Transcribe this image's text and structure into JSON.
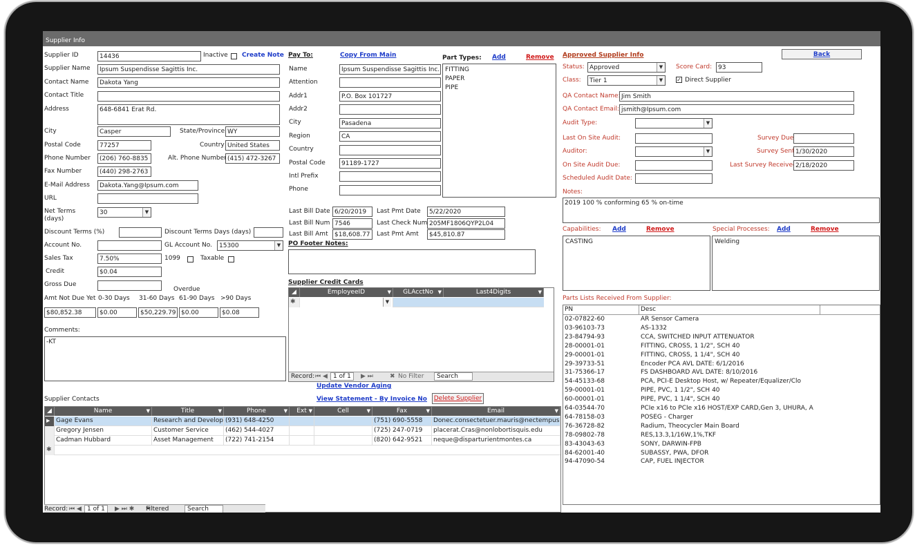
{
  "window_title": "Supplier Info",
  "supplier": {
    "labels": {
      "supplier_id": "Supplier ID",
      "inactive": "Inactive",
      "supplier_name": "Supplier Name",
      "contact_name": "Contact Name",
      "contact_title": "Contact Title",
      "address": "Address",
      "city": "City",
      "state": "State/Province",
      "postal": "Postal Code",
      "country": "Country",
      "phone": "Phone Number",
      "alt_phone": "Alt. Phone Number:",
      "fax": "Fax Number",
      "email": "E-Mail Address",
      "url": "URL",
      "net_terms": "Net Terms\n(days)",
      "discount_terms": "Discount Terms (%)",
      "discount_days": "Discount Terms Days (days)",
      "account_no": "Account No.",
      "gl_account": "GL Account No.",
      "sales_tax": "Sales Tax",
      "form_1099": "1099",
      "taxable": "Taxable",
      "credit": "Credit",
      "gross_due": "Gross Due",
      "overdue": "Overdue",
      "amt_not_due": "Amt Not Due Yet",
      "d0_30": "0-30 Days",
      "d31_60": "31-60 Days",
      "d61_90": "61-90 Days",
      "d90": ">90 Days",
      "comments": "Comments:"
    },
    "create_note": "Create Note",
    "values": {
      "supplier_id": "14436",
      "supplier_name": "Ipsum Suspendisse Sagittis Inc.",
      "contact_name": "Dakota Yang",
      "contact_title": "",
      "address": "648-6841 Erat Rd.",
      "city": "Casper",
      "state": "WY",
      "postal": "77257",
      "country": "United States",
      "phone": "(206) 760-8835",
      "alt_phone": "(415) 472-3267",
      "fax": "(440) 298-2763",
      "email": "Dakota.Yang@Ipsum.com",
      "url": "",
      "net_terms": "30",
      "discount_terms": "",
      "discount_days": "",
      "account_no": "",
      "gl_account": "15300",
      "sales_tax": "7.50%",
      "credit": "$0.04",
      "gross_due": "",
      "amt_not_due": "$80,852.38",
      "d0_30": "$0.00",
      "d31_60": "$50,229.79",
      "d61_90": "$0.00",
      "d90": "$0.08",
      "comments": "-KT"
    }
  },
  "pay_to": {
    "header": "Pay To:",
    "copy_from_main": "Copy From Main",
    "labels": {
      "name": "Name",
      "attention": "Attention",
      "addr1": "Addr1",
      "addr2": "Addr2",
      "city": "City",
      "region": "Region",
      "country": "Country",
      "postal": "Postal Code",
      "intl_prefix": "Intl Prefix",
      "phone": "Phone"
    },
    "values": {
      "name": "Ipsum Suspendisse Sagittis Inc.",
      "attention": "",
      "addr1": "P.O. Box 101727",
      "addr2": "",
      "city": "Pasadena",
      "region": "CA",
      "country": "",
      "postal": "91189-1727",
      "intl_prefix": "",
      "phone": ""
    }
  },
  "part_types": {
    "label": "Part Types:",
    "add": "Add",
    "remove": "Remove",
    "items": [
      "FITTING",
      "PAPER",
      "PIPE"
    ]
  },
  "billing": {
    "labels": {
      "last_bill_date": "Last Bill Date",
      "last_pmt_date": "Last Pmt Date",
      "last_bill_num": "Last Bill Num",
      "last_check_num": "Last Check Num",
      "last_bill_amt": "Last Bill Amt",
      "last_pmt_amt": "Last Pmt Amt"
    },
    "values": {
      "last_bill_date": "6/20/2019",
      "last_pmt_date": "5/22/2020",
      "last_bill_num": "7546",
      "last_check_num": "205MF1806QYP2L04",
      "last_bill_amt": "$18,608.77",
      "last_pmt_amt": "$45,810.87"
    }
  },
  "po_footer_label": "PO Footer Notes:",
  "credit_cards": {
    "label": "Supplier Credit Cards",
    "columns": [
      "EmployeeID",
      "GLAcctNo",
      "Last4Digits"
    ],
    "nav": {
      "record": "Record:",
      "pos": "1 of 1",
      "filter": "No Filter",
      "search": "Search"
    }
  },
  "links": {
    "update_vendor_aging": "Update Vendor Aging",
    "view_statement": "View Statement - By Invoice No",
    "delete_supplier": "Delete Supplier"
  },
  "contacts": {
    "label": "Supplier Contacts",
    "columns": [
      "Name",
      "Title",
      "Phone",
      "Ext",
      "Cell",
      "Fax",
      "Email"
    ],
    "rows": [
      [
        "Gage Evans",
        "Research and Developm",
        "(931) 648-4250",
        "",
        "",
        "(751) 690-5558",
        "Donec.consectetuer.mauris@nectempus"
      ],
      [
        "Gregory Jensen",
        "Customer Service",
        "(462) 544-4027",
        "",
        "",
        "(725) 247-0719",
        "placerat.Cras@nonlobortisquis.edu"
      ],
      [
        "Cadman Hubbard",
        "Asset Management",
        "(722) 741-2154",
        "",
        "",
        "(820) 642-9521",
        "neque@disparturientmontes.ca"
      ]
    ],
    "nav": {
      "record": "Record:",
      "pos": "1 of 1",
      "filtered": "Filtered",
      "search": "Search"
    }
  },
  "approved": {
    "header": "Approved Supplier Info",
    "back": "Back",
    "labels": {
      "status": "Status:",
      "score_card": "Score Card:",
      "class": "Class:",
      "direct": "Direct Supplier",
      "qa_contact_name": "QA Contact Name:",
      "qa_contact_email": "QA Contact Email:",
      "audit_type": "Audit Type:",
      "last_on_site": "Last On Site Audit:",
      "survey_due": "Survey Due:",
      "auditor": "Auditor:",
      "survey_sent": "Survey Sent:",
      "on_site_due": "On Site Audit Due:",
      "last_survey": "Last Survey Received:",
      "scheduled": "Scheduled Audit Date:",
      "notes": "Notes:"
    },
    "values": {
      "status": "Approved",
      "score_card": "93",
      "class": "Tier 1",
      "qa_contact_name": "Jim Smith",
      "qa_contact_email": "jsmith@Ipsum.com",
      "audit_type": "",
      "last_on_site": "",
      "survey_due": "",
      "auditor": "",
      "survey_sent": "1/30/2020",
      "on_site_due": "",
      "last_survey": "2/18/2020",
      "scheduled": "",
      "notes": "2019 100 % conforming 65 % on-time"
    }
  },
  "capabilities": {
    "label": "Capabilities:",
    "add": "Add",
    "remove": "Remove",
    "items": [
      "CASTING"
    ]
  },
  "special_processes": {
    "label": "Special Processes:",
    "add": "Add",
    "remove": "Remove",
    "items": [
      "Welding"
    ]
  },
  "parts_lists": {
    "label": "Parts Lists Received From Supplier:",
    "columns": [
      "PN",
      "Desc"
    ],
    "rows": [
      [
        "02-07822-60",
        "AR Sensor Camera"
      ],
      [
        "03-96103-73",
        "AS-1332"
      ],
      [
        "23-84794-93",
        "CCA, SWITCHED INPUT ATTENUATOR"
      ],
      [
        "28-00001-01",
        "FITTING, CROSS, 1 1/2\", SCH 40"
      ],
      [
        "29-00001-01",
        "FITTING, CROSS, 1 1/4\", SCH 40"
      ],
      [
        "29-39733-51",
        "Encoder PCA AVL DATE: 6/1/2016"
      ],
      [
        "31-75366-17",
        "FS  DASHBOARD AVL DATE: 8/10/2016"
      ],
      [
        "54-45133-68",
        "PCA, PCI-E Desktop Host, w/ Repeater/Equalizer/Clo"
      ],
      [
        "59-00001-01",
        "PIPE, PVC, 1 1/2\", SCH 40"
      ],
      [
        "60-00001-01",
        "PIPE, PVC, 1 1/4\", SCH 40"
      ],
      [
        "64-03544-70",
        "PCIe x16 to PCIe x16 HOST/EXP CARD,Gen 3, UHURA, A"
      ],
      [
        "64-78158-03",
        "POSEG - Charger"
      ],
      [
        "76-36728-82",
        "Radium, Theocycler Main Board"
      ],
      [
        "78-09802-78",
        "RES,13.3,1/16W,1%,TKF"
      ],
      [
        "83-43043-63",
        "SONY, DARWIN-FPB"
      ],
      [
        "84-62001-40",
        "SUBASSY, PWA, DFOR"
      ],
      [
        "94-47090-54",
        "CAP, FUEL INJECTOR"
      ]
    ]
  }
}
